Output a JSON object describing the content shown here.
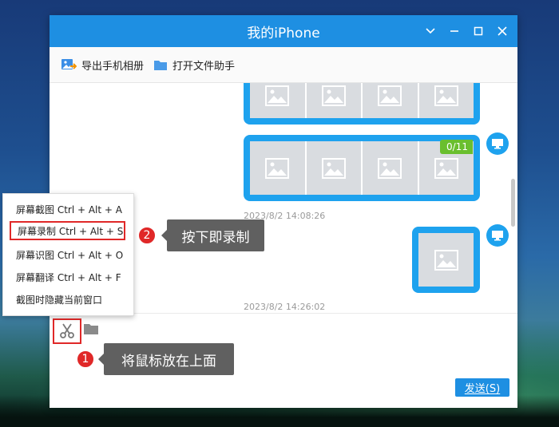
{
  "window": {
    "title": "我的iPhone"
  },
  "toolbar": {
    "export_album": "导出手机相册",
    "open_file_helper": "打开文件助手"
  },
  "chat": {
    "badge_progress": "0/11",
    "timestamp_1": "2023/8/2 14:08:26",
    "timestamp_2": "2023/8/2 14:26:02"
  },
  "input": {
    "send_label": "发送(S)"
  },
  "screenshot_menu": {
    "items": [
      "屏幕截图 Ctrl + Alt + A",
      "屏幕录制 Ctrl + Alt + S",
      "屏幕识图 Ctrl + Alt + O",
      "屏幕翻译 Ctrl + Alt + F",
      "截图时隐藏当前窗口"
    ]
  },
  "annotations": {
    "step1_number": "1",
    "step1_text": "将鼠标放在上面",
    "step2_number": "2",
    "step2_text": "按下即录制"
  },
  "colors": {
    "accent": "#1e8fe2",
    "bubble": "#1ea2ee",
    "highlight": "#e02828",
    "badge": "#6abf2e"
  }
}
